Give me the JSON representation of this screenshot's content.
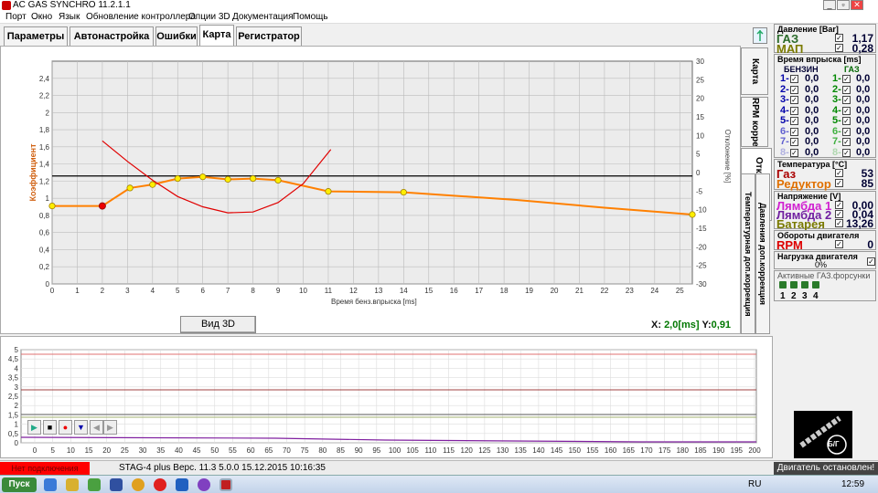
{
  "window": {
    "title": "AC GAS SYNCHRO  11.2.1.1",
    "minimize": "_",
    "maximize": "▫",
    "close": "✕"
  },
  "menu": [
    "Порт",
    "Окно",
    "Язык",
    "Обновление контроллера",
    "Опции 3D",
    "Документация",
    "Помощь"
  ],
  "tabs": [
    "Параметры",
    "Автонастройка",
    "Ошибки",
    "Карта",
    "Регистратор"
  ],
  "active_tab": "Карта",
  "side_tabs": [
    "Карта",
    "RPM коррекция",
    "Отклонения",
    "Температурная доп.коррекция",
    "Давления доп.коррекция"
  ],
  "view3d_button": "Вид 3D",
  "readout": {
    "x_label": "X:",
    "x_value": "2,0[ms]",
    "y_label": "Y:",
    "y_value": "0,91"
  },
  "chart_data": {
    "type": "line",
    "ylabel": "Коэффициент",
    "xlabel": "Время бенз.впрыска [ms]",
    "y2label": "Отклонение [%]",
    "xlim": [
      0,
      25.5
    ],
    "ylim": [
      0,
      2.6
    ],
    "y2lim": [
      -30,
      30
    ],
    "x_ticks": [
      0,
      1,
      2,
      3,
      4,
      5,
      6,
      7,
      8,
      9,
      10,
      11,
      12,
      13,
      14,
      15,
      16,
      17,
      18,
      19,
      20,
      21,
      22,
      23,
      24,
      25
    ],
    "y_ticks": [
      0,
      0.2,
      0.4,
      0.6,
      0.8,
      1,
      1.2,
      1.4,
      1.6,
      1.8,
      2,
      2.2,
      2.4
    ],
    "y_tick_labels": [
      "0",
      "0,2",
      "0,4",
      "0,6",
      "0,8",
      "1",
      "1,2",
      "1,4",
      "1,6",
      "1,8",
      "2",
      "2,2",
      "2,4"
    ],
    "y2_ticks": [
      -30,
      -25,
      -20,
      -15,
      -10,
      -5,
      0,
      5,
      10,
      15,
      20,
      25,
      30
    ],
    "reference_line_y": 1.26,
    "series": [
      {
        "color": "#ff8000",
        "points": [
          [
            0,
            0.91
          ],
          [
            2,
            0.91
          ],
          [
            3.1,
            1.12
          ],
          [
            4,
            1.16
          ],
          [
            5,
            1.23
          ],
          [
            6,
            1.25
          ],
          [
            7,
            1.22
          ],
          [
            8,
            1.23
          ],
          [
            9,
            1.21
          ],
          [
            11,
            1.08
          ],
          [
            14,
            1.07
          ],
          [
            18.5,
            0.98
          ],
          [
            22,
            0.89
          ],
          [
            25.5,
            0.81
          ]
        ],
        "markers": [
          [
            0,
            0.91
          ],
          [
            3.1,
            1.12
          ],
          [
            4,
            1.16
          ],
          [
            5,
            1.23
          ],
          [
            6,
            1.25
          ],
          [
            7,
            1.22
          ],
          [
            8,
            1.23
          ],
          [
            9,
            1.21
          ],
          [
            11,
            1.08
          ],
          [
            14,
            1.07
          ],
          [
            25.5,
            0.81
          ]
        ],
        "selected": [
          2,
          0.91
        ]
      },
      {
        "color": "#e00000",
        "points": [
          [
            2,
            1.67
          ],
          [
            3,
            1.43
          ],
          [
            4,
            1.21
          ],
          [
            5,
            1.02
          ],
          [
            6,
            0.9
          ],
          [
            7,
            0.83
          ],
          [
            8,
            0.84
          ],
          [
            9,
            0.95
          ],
          [
            10,
            1.17
          ],
          [
            11.1,
            1.57
          ]
        ]
      }
    ],
    "grid": true
  },
  "log_chart": {
    "y_tick_labels": [
      "0",
      "0,5",
      "1",
      "1,5",
      "2",
      "2,5",
      "3",
      "3,5",
      "4",
      "4,5",
      "5"
    ],
    "x_tick_labels": [
      "0",
      "5",
      "10",
      "15",
      "20",
      "25",
      "30",
      "35",
      "40",
      "45",
      "50",
      "55",
      "60",
      "65",
      "70",
      "75",
      "80",
      "85",
      "90",
      "95",
      "100",
      "105",
      "110",
      "115",
      "120",
      "125",
      "130",
      "135",
      "140",
      "145",
      "150",
      "155",
      "160",
      "165",
      "170",
      "175",
      "180",
      "185",
      "190",
      "195",
      "200"
    ]
  },
  "right_panel": {
    "pressure": {
      "title": "Давление [Bar]",
      "gas_label": "ГАЗ",
      "gas_value": "1,17",
      "map_label": "МАП",
      "map_value": "0,28"
    },
    "injection": {
      "title": "Время впрыска [ms]",
      "petrol": "БЕНЗИН",
      "gas": "ГАЗ",
      "rows": [
        [
          "1-",
          "0,0",
          "1-",
          "0,0"
        ],
        [
          "2-",
          "0,0",
          "2-",
          "0,0"
        ],
        [
          "3-",
          "0,0",
          "3-",
          "0,0"
        ],
        [
          "4-",
          "0,0",
          "4-",
          "0,0"
        ],
        [
          "5-",
          "0,0",
          "5-",
          "0,0"
        ],
        [
          "6-",
          "0,0",
          "6-",
          "0,0"
        ],
        [
          "7-",
          "0,0",
          "7-",
          "0,0"
        ],
        [
          "8-",
          "0,0",
          "8-",
          "0,0"
        ]
      ]
    },
    "temperature": {
      "title": "Температура  [°C]",
      "gas_label": "Газ",
      "gas_value": "53",
      "reducer_label": "Редуктор",
      "reducer_value": "85"
    },
    "voltage": {
      "title": "Напряжение [V]",
      "l1_label": "Лямбда 1",
      "l1_value": "0,00",
      "l2_label": "Лямбда 2",
      "l2_value": "0,04",
      "bat_label": "Батарея",
      "bat_value": "13,26"
    },
    "rpm": {
      "title": "Обороты двигателя",
      "label": "RPM",
      "value": "0"
    },
    "load": {
      "title": "Нагрузка двигателя",
      "value": "0%"
    },
    "injectors": {
      "title": "Активные ГАЗ.форсунки",
      "labels": [
        "1",
        "2",
        "3",
        "4"
      ]
    }
  },
  "logo_text": "Б/Г",
  "status": {
    "connection": "Нет подключения",
    "info": "STAG-4 plus   Верс. 11.3  5.0.0     15.12.2015 10:16:35",
    "engine": "Двигатель остановлен!"
  },
  "taskbar": {
    "start": "Пуск",
    "lang": "RU",
    "time": "12:59"
  }
}
